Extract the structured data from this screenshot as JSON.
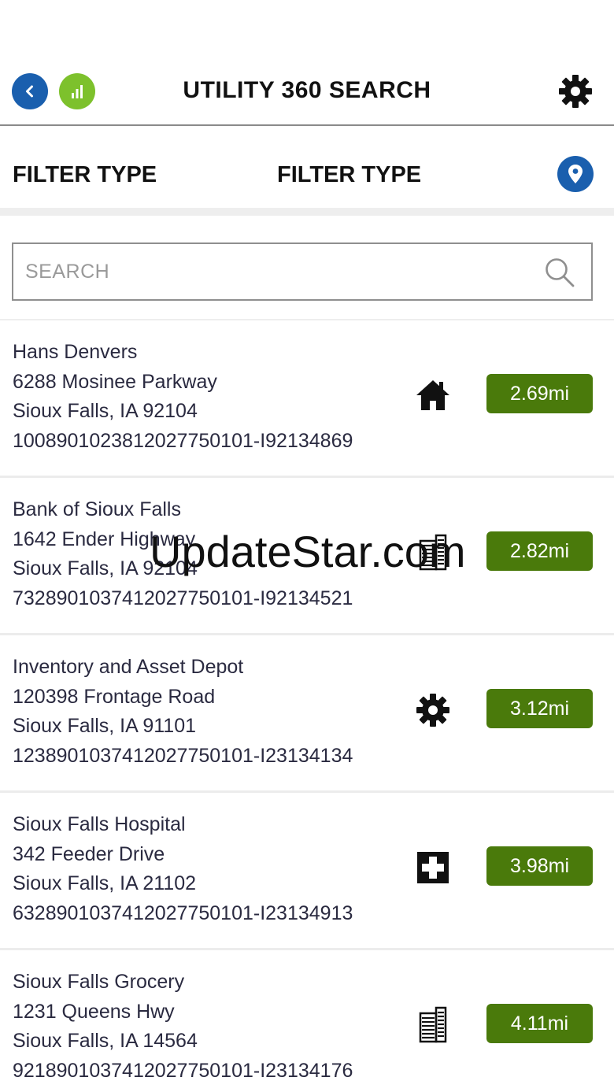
{
  "header": {
    "title": "UTILITY 360 SEARCH",
    "icons": {
      "back": "chevron-left-icon",
      "signal": "signal-bars-icon",
      "settings": "gear-icon"
    },
    "colors": {
      "back": "#1a5fae",
      "signal": "#7dc12c"
    }
  },
  "filters": {
    "filter_1": "FILTER TYPE",
    "filter_2": "FILTER TYPE",
    "location_icon": "map-pin-icon"
  },
  "search": {
    "placeholder": "SEARCH",
    "value": "",
    "icon": "search-icon"
  },
  "results": [
    {
      "name": "Hans Denvers",
      "street": "6288 Mosinee Parkway",
      "city": "Sioux Falls, IA 92104",
      "account": "1008901023812027750101-I92134869",
      "type_icon": "house-icon",
      "distance": "2.69mi"
    },
    {
      "name": "Bank of Sioux Falls",
      "street": "1642 Ender Highway",
      "city": "Sioux Falls, IA 92104",
      "account": "7328901037412027750101-I92134521",
      "type_icon": "building-icon",
      "distance": "2.82mi"
    },
    {
      "name": "Inventory and Asset Depot",
      "street": "120398 Frontage Road",
      "city": "Sioux Falls, IA 91101",
      "account": "1238901037412027750101-I23134134",
      "type_icon": "gear-icon",
      "distance": "3.12mi"
    },
    {
      "name": "Sioux Falls Hospital",
      "street": "342 Feeder Drive",
      "city": "Sioux Falls, IA 21102",
      "account": "6328901037412027750101-I23134913",
      "type_icon": "medical-cross-icon",
      "distance": "3.98mi"
    },
    {
      "name": "Sioux Falls Grocery",
      "street": "1231 Queens Hwy",
      "city": "Sioux Falls, IA 14564",
      "account": "9218901037412027750101-I23134176",
      "type_icon": "building-icon",
      "distance": "4.11mi"
    }
  ],
  "colors": {
    "distance_badge": "#4a7a0b",
    "pin": "#1a5fae"
  },
  "watermark": "UpdateStar.com"
}
